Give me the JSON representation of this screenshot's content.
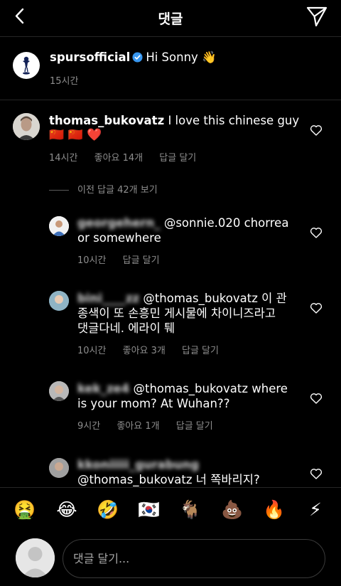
{
  "header": {
    "title": "댓글"
  },
  "caption": {
    "username": "spursofficial",
    "text": "Hi Sonny 👋",
    "time": "15시간"
  },
  "comments": [
    {
      "username": "thomas_bukovatz",
      "text_line1": "I love this chinese guy",
      "text_line2": "🇨🇳 🇨🇳 ❤️",
      "time": "14시간",
      "likes": "좋아요 14개",
      "reply": "답글 달기"
    },
    {
      "username": "georgehern_",
      "text_line1": "@sonnie.020 chorrea",
      "text_line2": "or somewhere",
      "time": "10시간",
      "reply": "답글 달기"
    },
    {
      "username": "bini____zz",
      "text_line1": "@thomas_bukovatz 이 관",
      "text_line2": "종색이 또 손흥민 게시물에 차이니즈라고",
      "text_line3": "댓글다네. 에라이 퉤",
      "time": "10시간",
      "likes": "좋아요 3개",
      "reply": "답글 달기"
    },
    {
      "username": "kek_ze4",
      "text_line1": "@thomas_bukovatz where",
      "text_line2": "is your mom? At Wuhan??",
      "time": "9시간",
      "likes": "좋아요 1개",
      "reply": "답글 달기"
    },
    {
      "username": "kkoniiiii_gurabung",
      "text_line1": "@thomas_bukovatz 너 쪽바리지?"
    }
  ],
  "view_previous": "이전 답글 42개 보기",
  "emojis": [
    "🤮",
    "😂",
    "🤣",
    "🇰🇷",
    "🐐",
    "💩",
    "🔥",
    "⚡"
  ],
  "composer": {
    "placeholder": "댓글 달기..."
  },
  "colors": {
    "background": "#000000",
    "secondary_text": "#8e8e8e",
    "verified": "#3897f0",
    "divider": "#262626"
  }
}
